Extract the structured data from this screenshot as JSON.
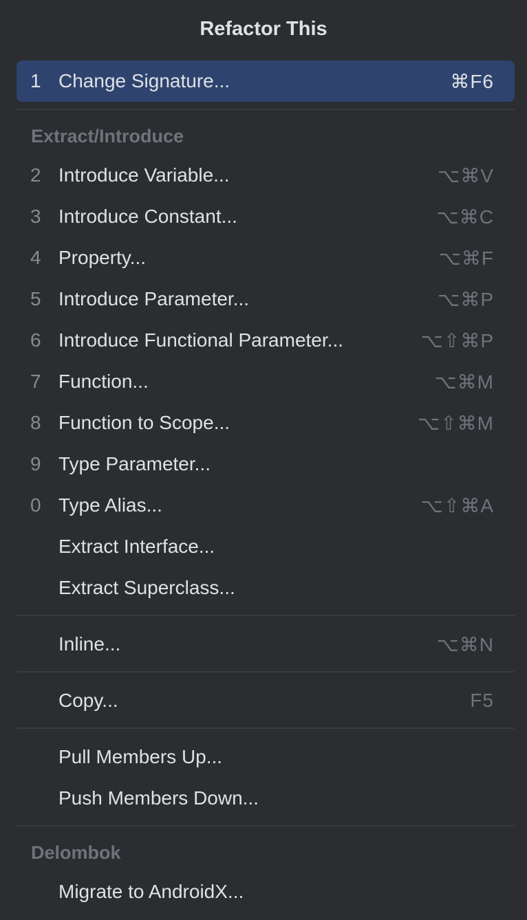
{
  "title": "Refactor This",
  "selected": {
    "num": "1",
    "label": "Change Signature...",
    "shortcut": "⌘F6"
  },
  "sections": {
    "extract_header": "Extract/Introduce",
    "delombok_header": "Delombok"
  },
  "items": [
    {
      "num": "2",
      "label": "Introduce Variable...",
      "shortcut": "⌥⌘V"
    },
    {
      "num": "3",
      "label": "Introduce Constant...",
      "shortcut": "⌥⌘C"
    },
    {
      "num": "4",
      "label": "Property...",
      "shortcut": "⌥⌘F"
    },
    {
      "num": "5",
      "label": "Introduce Parameter...",
      "shortcut": "⌥⌘P"
    },
    {
      "num": "6",
      "label": "Introduce Functional Parameter...",
      "shortcut": "⌥⇧⌘P"
    },
    {
      "num": "7",
      "label": "Function...",
      "shortcut": "⌥⌘M"
    },
    {
      "num": "8",
      "label": "Function to Scope...",
      "shortcut": "⌥⇧⌘M"
    },
    {
      "num": "9",
      "label": "Type Parameter...",
      "shortcut": ""
    },
    {
      "num": "0",
      "label": "Type Alias...",
      "shortcut": "⌥⇧⌘A"
    },
    {
      "num": "",
      "label": "Extract Interface...",
      "shortcut": ""
    },
    {
      "num": "",
      "label": "Extract Superclass...",
      "shortcut": ""
    },
    {
      "num": "",
      "label": "Inline...",
      "shortcut": "⌥⌘N"
    },
    {
      "num": "",
      "label": "Copy...",
      "shortcut": "F5"
    },
    {
      "num": "",
      "label": "Pull Members Up...",
      "shortcut": ""
    },
    {
      "num": "",
      "label": "Push Members Down...",
      "shortcut": ""
    },
    {
      "num": "",
      "label": "Migrate to AndroidX...",
      "shortcut": ""
    }
  ],
  "colors": {
    "background": "#2b2d30",
    "selection": "#2e436e",
    "text": "#dfe1e5",
    "muted": "#6f737a",
    "separator": "#393b40"
  }
}
